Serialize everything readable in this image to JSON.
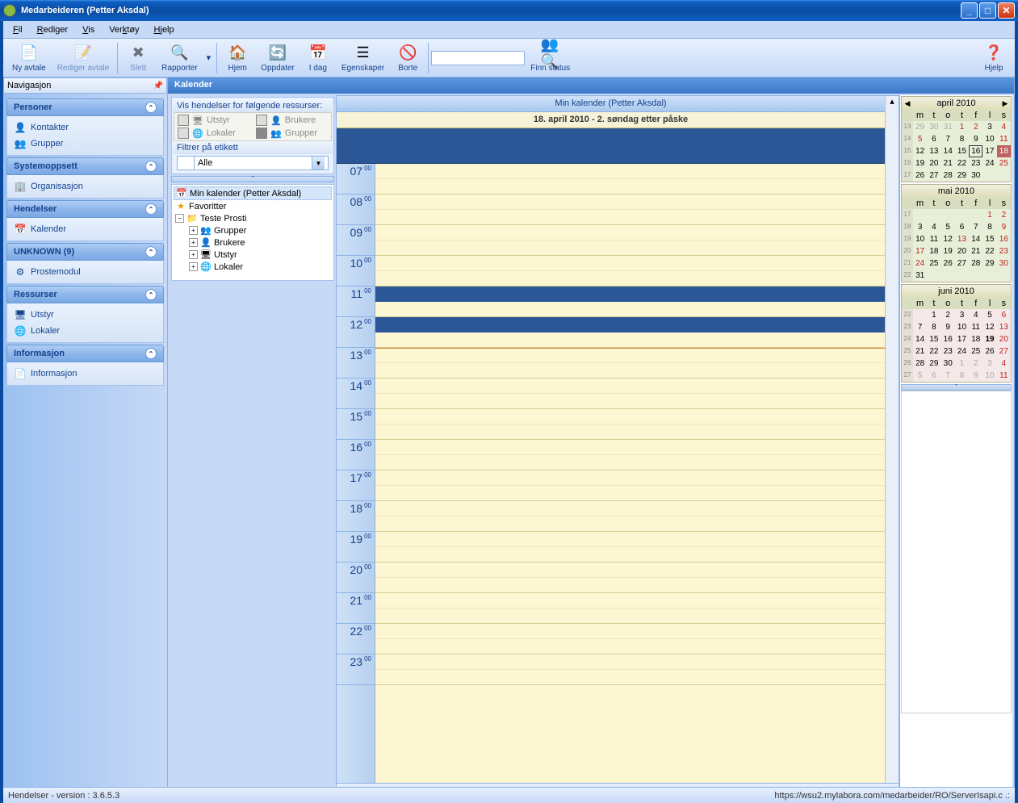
{
  "window": {
    "title": "Medarbeideren (Petter Aksdal)"
  },
  "menu": {
    "fil": "Fil",
    "rediger": "Rediger",
    "vis": "Vis",
    "verktoy": "Verktøy",
    "hjelp": "Hjelp"
  },
  "toolbar": {
    "ny": "Ny avtale",
    "rediger": "Rediger avtale",
    "slett": "Slett",
    "rapporter": "Rapporter",
    "hjem": "Hjem",
    "oppdater": "Oppdater",
    "idag": "I dag",
    "egen": "Egenskaper",
    "borte": "Borte",
    "finn": "Finn status",
    "hjelp": "Hjelp"
  },
  "nav": {
    "title": "Navigasjon",
    "personer": {
      "hdr": "Personer",
      "kontakter": "Kontakter",
      "grupper": "Grupper"
    },
    "system": {
      "hdr": "Systemoppsett",
      "org": "Organisasjon"
    },
    "hendelser": {
      "hdr": "Hendelser",
      "kal": "Kalender"
    },
    "unknown": {
      "hdr": "UNKNOWN (9)",
      "proste": "Prostemodul"
    },
    "ressurser": {
      "hdr": "Ressurser",
      "utstyr": "Utstyr",
      "lokaler": "Lokaler"
    },
    "info": {
      "hdr": "Informasjon",
      "info": "Informasjon"
    }
  },
  "center": {
    "title": "Kalender",
    "filter_hdr": "Vis hendelser for følgende ressurser:",
    "utstyr": "Utstyr",
    "brukere": "Brukere",
    "lokaler": "Lokaler",
    "grupper": "Grupper",
    "etikett_hdr": "Filtrer på etikett",
    "etikett_val": "Alle",
    "tree": {
      "mincal": "Min kalender (Petter Aksdal)",
      "fav": "Favoritter",
      "teste": "Teste Prosti",
      "grupper": "Grupper",
      "brukere": "Brukere",
      "utstyr": "Utstyr",
      "lokaler": "Lokaler"
    }
  },
  "calendar": {
    "hdr1": "Min kalender (Petter Aksdal)",
    "hdr2": "18. april 2010 - 2. søndag etter påske",
    "hours": [
      "07",
      "08",
      "09",
      "10",
      "11",
      "12",
      "13",
      "14",
      "15",
      "16",
      "17",
      "18",
      "19",
      "20",
      "21",
      "22",
      "23"
    ]
  },
  "minicals": {
    "dow": [
      "m",
      "t",
      "o",
      "t",
      "f",
      "l",
      "s"
    ],
    "april": {
      "name": "april 2010",
      "wks": [
        "13",
        "14",
        "15",
        "16",
        "17"
      ],
      "rows": [
        [
          {
            "d": "29",
            "c": "other"
          },
          {
            "d": "30",
            "c": "other"
          },
          {
            "d": "31",
            "c": "other"
          },
          {
            "d": "1",
            "c": "red"
          },
          {
            "d": "2",
            "c": "red"
          },
          {
            "d": "3",
            "c": ""
          },
          {
            "d": "4",
            "c": "red"
          }
        ],
        [
          {
            "d": "5",
            "c": "red"
          },
          {
            "d": "6",
            "c": ""
          },
          {
            "d": "7",
            "c": ""
          },
          {
            "d": "8",
            "c": ""
          },
          {
            "d": "9",
            "c": ""
          },
          {
            "d": "10",
            "c": ""
          },
          {
            "d": "11",
            "c": "red"
          }
        ],
        [
          {
            "d": "12",
            "c": ""
          },
          {
            "d": "13",
            "c": ""
          },
          {
            "d": "14",
            "c": ""
          },
          {
            "d": "15",
            "c": ""
          },
          {
            "d": "16",
            "c": "today"
          },
          {
            "d": "17",
            "c": ""
          },
          {
            "d": "18",
            "c": "sel"
          }
        ],
        [
          {
            "d": "19",
            "c": ""
          },
          {
            "d": "20",
            "c": ""
          },
          {
            "d": "21",
            "c": ""
          },
          {
            "d": "22",
            "c": ""
          },
          {
            "d": "23",
            "c": ""
          },
          {
            "d": "24",
            "c": ""
          },
          {
            "d": "25",
            "c": "red"
          }
        ],
        [
          {
            "d": "26",
            "c": ""
          },
          {
            "d": "27",
            "c": ""
          },
          {
            "d": "28",
            "c": ""
          },
          {
            "d": "29",
            "c": ""
          },
          {
            "d": "30",
            "c": ""
          },
          {
            "d": "",
            "c": ""
          },
          {
            "d": "",
            "c": ""
          }
        ]
      ]
    },
    "mai": {
      "name": "mai 2010",
      "wks": [
        "17",
        "18",
        "19",
        "20",
        "21",
        "22"
      ],
      "rows": [
        [
          {
            "d": "",
            "c": ""
          },
          {
            "d": "",
            "c": ""
          },
          {
            "d": "",
            "c": ""
          },
          {
            "d": "",
            "c": ""
          },
          {
            "d": "",
            "c": ""
          },
          {
            "d": "1",
            "c": "red"
          },
          {
            "d": "2",
            "c": "red"
          }
        ],
        [
          {
            "d": "3",
            "c": ""
          },
          {
            "d": "4",
            "c": ""
          },
          {
            "d": "5",
            "c": ""
          },
          {
            "d": "6",
            "c": ""
          },
          {
            "d": "7",
            "c": ""
          },
          {
            "d": "8",
            "c": ""
          },
          {
            "d": "9",
            "c": "red"
          }
        ],
        [
          {
            "d": "10",
            "c": ""
          },
          {
            "d": "11",
            "c": ""
          },
          {
            "d": "12",
            "c": ""
          },
          {
            "d": "13",
            "c": "red"
          },
          {
            "d": "14",
            "c": ""
          },
          {
            "d": "15",
            "c": ""
          },
          {
            "d": "16",
            "c": "red"
          }
        ],
        [
          {
            "d": "17",
            "c": "red"
          },
          {
            "d": "18",
            "c": ""
          },
          {
            "d": "19",
            "c": ""
          },
          {
            "d": "20",
            "c": ""
          },
          {
            "d": "21",
            "c": ""
          },
          {
            "d": "22",
            "c": ""
          },
          {
            "d": "23",
            "c": "red"
          }
        ],
        [
          {
            "d": "24",
            "c": "red"
          },
          {
            "d": "25",
            "c": ""
          },
          {
            "d": "26",
            "c": ""
          },
          {
            "d": "27",
            "c": ""
          },
          {
            "d": "28",
            "c": ""
          },
          {
            "d": "29",
            "c": ""
          },
          {
            "d": "30",
            "c": "red"
          }
        ],
        [
          {
            "d": "31",
            "c": ""
          },
          {
            "d": "",
            "c": ""
          },
          {
            "d": "",
            "c": ""
          },
          {
            "d": "",
            "c": ""
          },
          {
            "d": "",
            "c": ""
          },
          {
            "d": "",
            "c": ""
          },
          {
            "d": "",
            "c": ""
          }
        ]
      ]
    },
    "juni": {
      "name": "juni 2010",
      "wks": [
        "22",
        "23",
        "24",
        "25",
        "26",
        "27"
      ],
      "rows": [
        [
          {
            "d": "",
            "c": ""
          },
          {
            "d": "1",
            "c": ""
          },
          {
            "d": "2",
            "c": ""
          },
          {
            "d": "3",
            "c": ""
          },
          {
            "d": "4",
            "c": ""
          },
          {
            "d": "5",
            "c": ""
          },
          {
            "d": "6",
            "c": "red"
          }
        ],
        [
          {
            "d": "7",
            "c": ""
          },
          {
            "d": "8",
            "c": ""
          },
          {
            "d": "9",
            "c": ""
          },
          {
            "d": "10",
            "c": ""
          },
          {
            "d": "11",
            "c": ""
          },
          {
            "d": "12",
            "c": ""
          },
          {
            "d": "13",
            "c": "red"
          }
        ],
        [
          {
            "d": "14",
            "c": ""
          },
          {
            "d": "15",
            "c": ""
          },
          {
            "d": "16",
            "c": ""
          },
          {
            "d": "17",
            "c": ""
          },
          {
            "d": "18",
            "c": ""
          },
          {
            "d": "19",
            "c": "bold"
          },
          {
            "d": "20",
            "c": "red"
          }
        ],
        [
          {
            "d": "21",
            "c": ""
          },
          {
            "d": "22",
            "c": ""
          },
          {
            "d": "23",
            "c": ""
          },
          {
            "d": "24",
            "c": ""
          },
          {
            "d": "25",
            "c": ""
          },
          {
            "d": "26",
            "c": ""
          },
          {
            "d": "27",
            "c": "red"
          }
        ],
        [
          {
            "d": "28",
            "c": ""
          },
          {
            "d": "29",
            "c": ""
          },
          {
            "d": "30",
            "c": ""
          },
          {
            "d": "1",
            "c": "other"
          },
          {
            "d": "2",
            "c": "other"
          },
          {
            "d": "3",
            "c": "other"
          },
          {
            "d": "4",
            "c": "other red"
          }
        ],
        [
          {
            "d": "5",
            "c": "other"
          },
          {
            "d": "6",
            "c": "other"
          },
          {
            "d": "7",
            "c": "other"
          },
          {
            "d": "8",
            "c": "other"
          },
          {
            "d": "9",
            "c": "other"
          },
          {
            "d": "10",
            "c": "other"
          },
          {
            "d": "11",
            "c": "other red"
          }
        ]
      ]
    }
  },
  "status": {
    "left": "Hendelser - version : 3.6.5.3",
    "right": "https://wsu2.mylabora.com/medarbeider/RO/ServerIsapi.c .:"
  }
}
